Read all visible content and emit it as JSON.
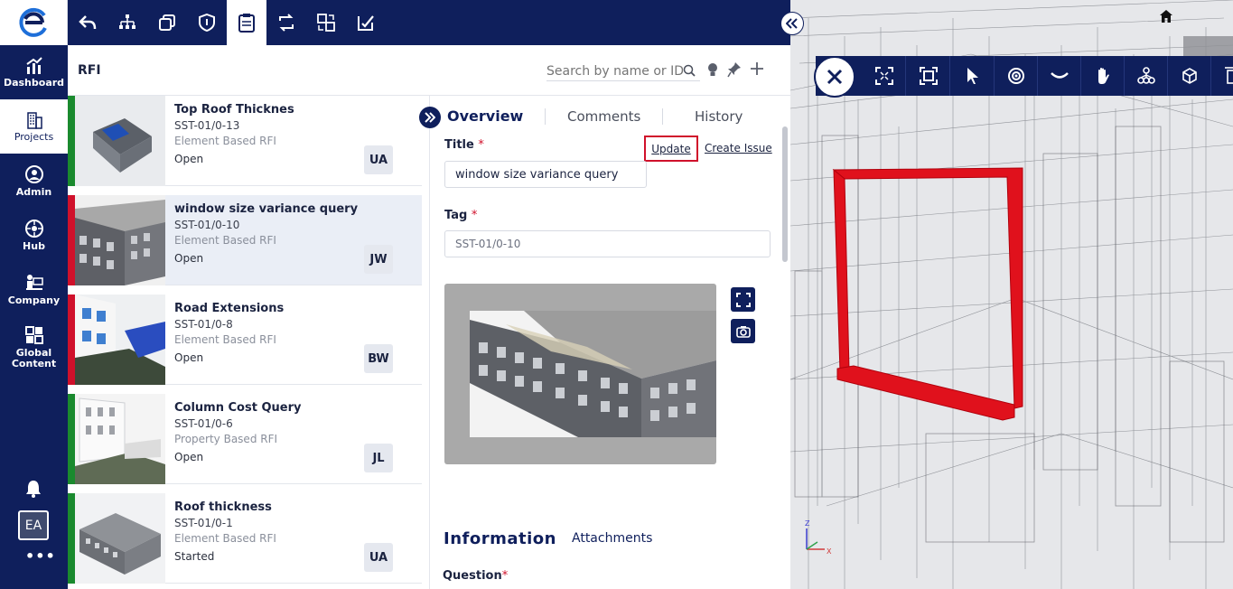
{
  "nav": {
    "items": [
      {
        "label": "Dashboard",
        "icon": "chart-icon"
      },
      {
        "label": "Projects",
        "icon": "building-icon"
      },
      {
        "label": "Admin",
        "icon": "admin-icon"
      },
      {
        "label": "Hub",
        "icon": "hub-icon"
      },
      {
        "label": "Company",
        "icon": "company-icon"
      },
      {
        "label_line1": "Global",
        "label_line2": "Content",
        "icon": "grid-icon"
      }
    ],
    "user_initials": "EA",
    "more": "•••"
  },
  "toolbar": {
    "icons": [
      "back-arrow-icon",
      "hierarchy-icon",
      "copy-icon",
      "shield-icon",
      "clipboard-rfi-icon",
      "sync-icon",
      "compare-icon",
      "checklist-icon"
    ],
    "active_index": 4
  },
  "header": {
    "title": "RFI",
    "search_placeholder": "Search by name or ID"
  },
  "rfi_list": [
    {
      "title": "Top Roof Thicknes",
      "code": "SST-01/0-13",
      "type": "Element Based RFI",
      "status": "Open",
      "assignee": "UA",
      "status_color": "#1a8a2e"
    },
    {
      "title": "window size variance query",
      "code": "SST-01/0-10",
      "type": "Element Based RFI",
      "status": "Open",
      "assignee": "JW",
      "status_color": "#d0112b"
    },
    {
      "title": "Road Extensions",
      "code": "SST-01/0-8",
      "type": "Element Based RFI",
      "status": "Open",
      "assignee": "BW",
      "status_color": "#d0112b"
    },
    {
      "title": "Column Cost Query",
      "code": "SST-01/0-6",
      "type": "Property Based RFI",
      "status": "Open",
      "assignee": "JL",
      "status_color": "#1a8a2e"
    },
    {
      "title": "Roof thickness",
      "code": "SST-01/0-1",
      "type": "Element Based RFI",
      "status": "Started",
      "assignee": "UA",
      "status_color": "#1a8a2e"
    }
  ],
  "detail": {
    "tabs": [
      "Overview",
      "Comments",
      "History"
    ],
    "title_label": "Title",
    "required_mark": "*",
    "update_link": "Update",
    "create_issue_link": "Create Issue",
    "title_value": "window size variance query",
    "tag_label": "Tag",
    "tag_value": "SST-01/0-10",
    "section_tabs": [
      "Information",
      "Attachments"
    ],
    "question_label": "Question"
  },
  "viewer": {
    "tools": [
      "close-icon",
      "fit-view-icon",
      "focus-icon",
      "select-icon",
      "orbit-icon",
      "look-icon",
      "pan-icon",
      "tree-icon",
      "cube-icon"
    ],
    "axis_labels": [
      "Z",
      "X"
    ]
  },
  "colors": {
    "navy": "#0f1f5c",
    "red": "#d0112b",
    "green": "#1a8a2e"
  }
}
